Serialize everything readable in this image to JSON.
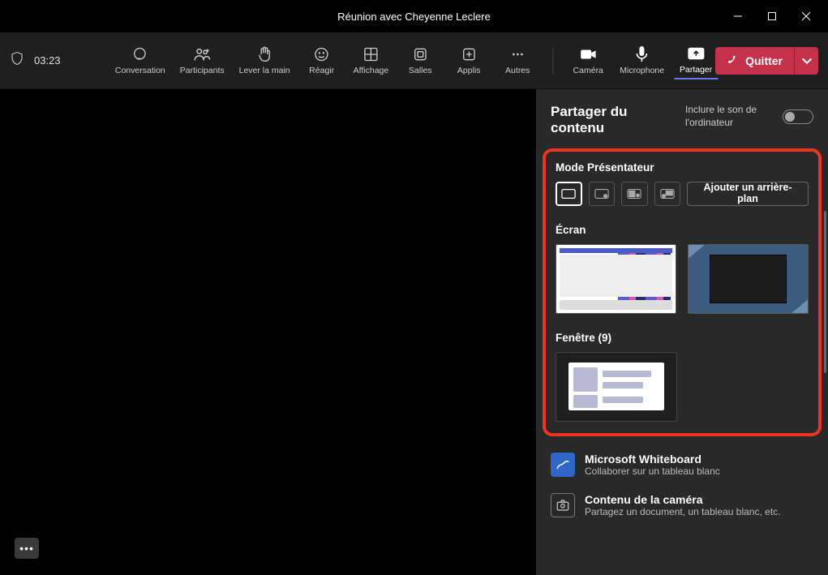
{
  "titlebar": {
    "title": "Réunion avec Cheyenne Leclere"
  },
  "toolbar": {
    "timer": "03:23",
    "buttons": {
      "conversation": "Conversation",
      "participants": "Participants",
      "raise_hand": "Lever la main",
      "react": "Réagir",
      "view": "Affichage",
      "rooms": "Salles",
      "apps": "Applis",
      "more": "Autres",
      "camera": "Caméra",
      "microphone": "Microphone",
      "share": "Partager"
    },
    "quit_label": "Quitter"
  },
  "share_panel": {
    "title": "Partager du contenu",
    "include_audio_label": "Inclure le son de l'ordinateur",
    "include_audio_on": false,
    "presenter_mode_title": "Mode Présentateur",
    "add_background_label": "Ajouter un arrière-plan",
    "screen_title": "Écran",
    "window_title": "Fenêtre (9)",
    "whiteboard": {
      "title": "Microsoft Whiteboard",
      "subtitle": "Collaborer sur un tableau blanc"
    },
    "camera_content": {
      "title": "Contenu de la caméra",
      "subtitle": "Partagez un document, un tableau blanc, etc."
    }
  }
}
